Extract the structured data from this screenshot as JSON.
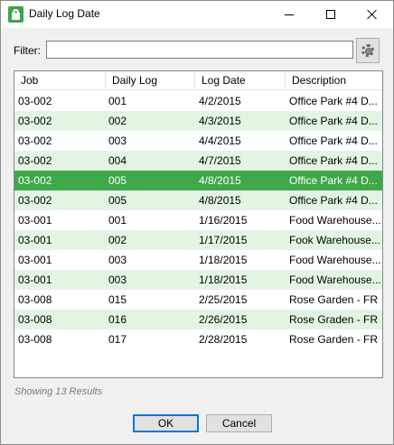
{
  "window": {
    "title": "Daily Log Date",
    "app_icon": "app-icon"
  },
  "filter": {
    "label": "Filter:",
    "value": "",
    "placeholder": "",
    "settings_icon": "gear-icon"
  },
  "grid": {
    "columns": [
      "Job",
      "Daily Log",
      "Log Date",
      "Description"
    ],
    "rows": [
      [
        "03-002",
        "001",
        "4/2/2015",
        "Office Park #4 D..."
      ],
      [
        "03-002",
        "002",
        "4/3/2015",
        "Office Park #4 D..."
      ],
      [
        "03-002",
        "003",
        "4/4/2015",
        "Office Park #4 D..."
      ],
      [
        "03-002",
        "004",
        "4/7/2015",
        "Office Park #4 D..."
      ],
      [
        "03-002",
        "005",
        "4/8/2015",
        "Office Park #4 D..."
      ],
      [
        "03-002",
        "005",
        "4/8/2015",
        "Office Park #4 D..."
      ],
      [
        "03-001",
        "001",
        "1/16/2015",
        "Food Warehouse..."
      ],
      [
        "03-001",
        "002",
        "1/17/2015",
        "Fook Warehouse..."
      ],
      [
        "03-001",
        "003",
        "1/18/2015",
        "Food Warehouse..."
      ],
      [
        "03-001",
        "003",
        "1/18/2015",
        "Food Warehouse..."
      ],
      [
        "03-008",
        "015",
        "2/25/2015",
        "Rose Garden - FR"
      ],
      [
        "03-008",
        "016",
        "2/26/2015",
        "Rose Graden - FR"
      ],
      [
        "03-008",
        "017",
        "2/28/2015",
        "Rose Garden - FR"
      ]
    ],
    "selected_row": 4
  },
  "status": "Showing 13 Results",
  "buttons": {
    "ok": "OK",
    "cancel": "Cancel"
  },
  "colors": {
    "selection": "#3ea84a",
    "alt_row": "#e3f4e3",
    "accent": "#0078d7"
  }
}
